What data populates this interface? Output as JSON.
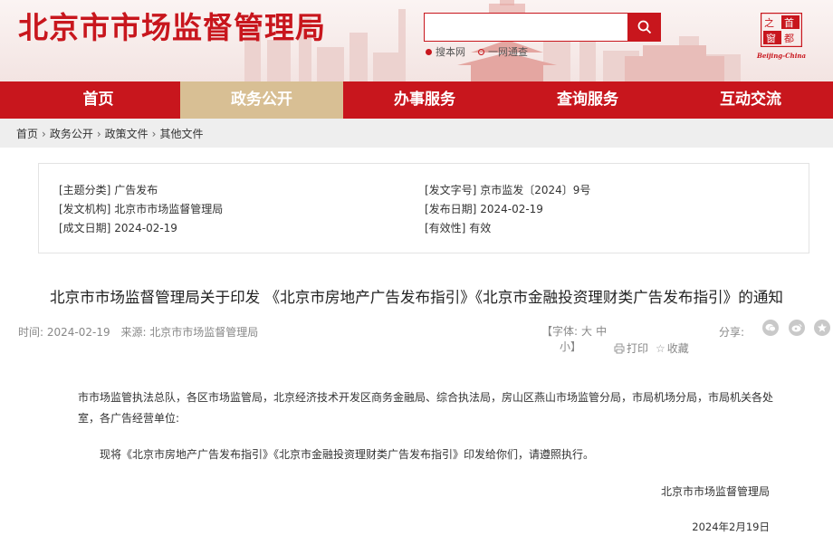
{
  "header": {
    "site_title": "北京市市场监督管理局",
    "search": {
      "value": "",
      "placeholder": ""
    },
    "search_scopes": [
      {
        "label": "搜本网",
        "selected": true
      },
      {
        "label": "一网通查",
        "selected": false
      }
    ],
    "logo_text": "Beijing-China",
    "logo_chars": [
      "首",
      "都",
      "之",
      "窗"
    ]
  },
  "nav": {
    "items": [
      {
        "label": "首页",
        "active": false
      },
      {
        "label": "政务公开",
        "active": true
      },
      {
        "label": "办事服务",
        "active": false
      },
      {
        "label": "查询服务",
        "active": false
      },
      {
        "label": "互动交流",
        "active": false
      }
    ]
  },
  "breadcrumb": [
    "首页",
    "政务公开",
    "政策文件",
    "其他文件"
  ],
  "meta": {
    "topic_key": "[主题分类]",
    "topic_val": "广告发布",
    "doc_no_key": "[发文字号]",
    "doc_no_val": "京市监发〔2024〕9号",
    "issuer_key": "[发文机构]",
    "issuer_val": "北京市市场监督管理局",
    "publish_key": "[发布日期]",
    "publish_val": "2024-02-19",
    "written_key": "[成文日期]",
    "written_val": "2024-02-19",
    "validity_key": "[有效性]",
    "validity_val": "有效"
  },
  "article": {
    "title": "北京市市场监督管理局关于印发 《北京市房地产广告发布指引》《北京市金融投资理财类广告发布指引》的通知",
    "time": "时间: 2024-02-19",
    "source": "来源: 北京市市场监督管理局",
    "font_label": "【字体:",
    "font_large": "大",
    "font_medium": "中",
    "font_small": "小】",
    "print_label": "打印",
    "fav_label": "收藏",
    "share_label": "分享:",
    "para1": "市市场监管执法总队，各区市场监管局，北京经济技术开发区商务金融局、综合执法局，房山区燕山市场监管分局，市局机场分局，市局机关各处室，各广告经营单位:",
    "para2": "现将《北京市房地产广告发布指引》《北京市金融投资理财类广告发布指引》印发给你们，请遵照执行。",
    "signature": "北京市市场监督管理局",
    "date": "2024年2月19日"
  },
  "colors": {
    "brand": "#c8161d",
    "nav_active": "#d8bf94"
  }
}
